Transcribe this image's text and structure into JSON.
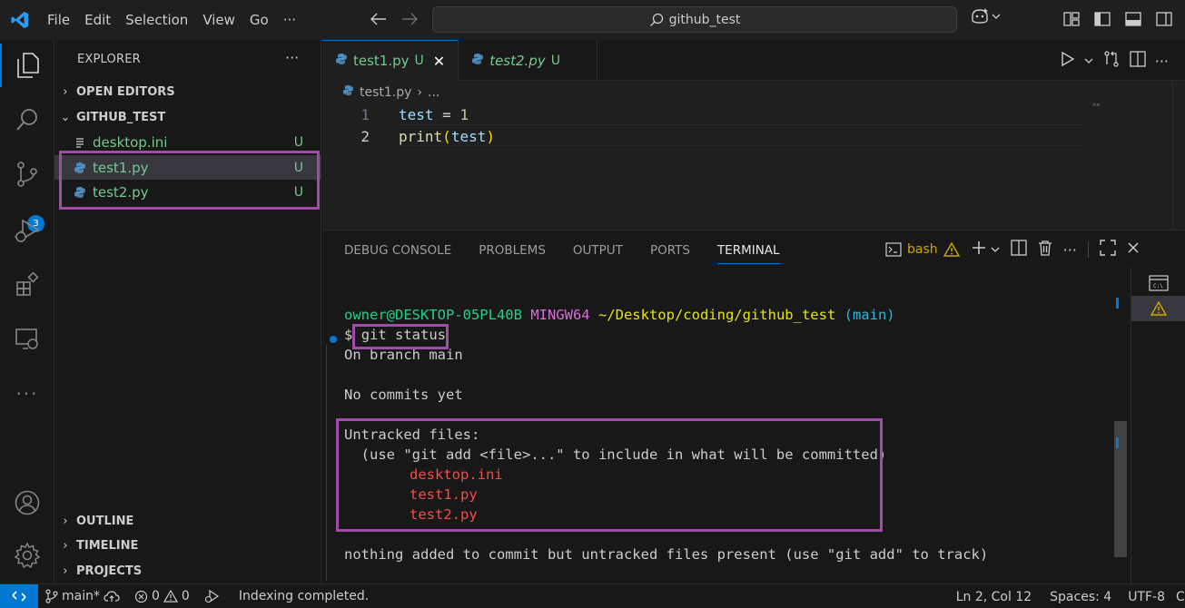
{
  "titlebar": {
    "menu": [
      "File",
      "Edit",
      "Selection",
      "View",
      "Go"
    ],
    "more": "···",
    "search_text": "github_test"
  },
  "activity": {
    "scm_badge": "3"
  },
  "sidebar": {
    "title": "EXPLORER",
    "more": "···",
    "open_editors": "OPEN EDITORS",
    "folder": "GITHUB_TEST",
    "files": [
      {
        "name": "desktop.ini",
        "status": "U",
        "icon": "file-lines-icon"
      },
      {
        "name": "test1.py",
        "status": "U",
        "icon": "python-icon"
      },
      {
        "name": "test2.py",
        "status": "U",
        "icon": "python-icon"
      }
    ],
    "outline": "OUTLINE",
    "timeline": "TIMELINE",
    "projects": "PROJECTS"
  },
  "editor": {
    "tabs": [
      {
        "label": "test1.py",
        "status": "U",
        "active": true
      },
      {
        "label": "test2.py",
        "status": "U",
        "active": false
      }
    ],
    "breadcrumb": {
      "file": "test1.py",
      "rest": "..."
    },
    "lines": [
      {
        "num": "1",
        "var": "test",
        "op": " = ",
        "val": "1"
      },
      {
        "num": "2",
        "fn": "print",
        "open": "(",
        "arg": "test",
        "close": ")"
      }
    ]
  },
  "panel": {
    "tabs": [
      "DEBUG CONSOLE",
      "PROBLEMS",
      "OUTPUT",
      "PORTS",
      "TERMINAL"
    ],
    "active_tab": "TERMINAL",
    "shell": "bash",
    "terminal": {
      "prompt_user": "owner@DESKTOP-05PL40B",
      "prompt_env": "MINGW64",
      "prompt_path": "~/Desktop/coding/github_test",
      "prompt_branch": "(main)",
      "dollar": "$",
      "command": "git status",
      "line_branch": "On branch main",
      "line_commits": "No commits yet",
      "line_untracked": "Untracked files:",
      "line_hint": "  (use \"git add <file>...\" to include in what will be committed)",
      "untracked": [
        "desktop.ini",
        "test1.py",
        "test2.py"
      ],
      "line_nothing": "nothing added to commit but untracked files present (use \"git add\" to track)"
    }
  },
  "statusbar": {
    "branch": "main*",
    "errors": "0",
    "warnings": "0",
    "message": "Indexing completed.",
    "position": "Ln 2, Col 12",
    "spaces": "Spaces: 4",
    "encoding": "UTF-8",
    "cut": "C"
  },
  "colors": {
    "accent": "#0078d4",
    "untracked_green": "#73c991",
    "highlight_purple": "#a04ca8",
    "terminal_red": "#f14c4c"
  }
}
